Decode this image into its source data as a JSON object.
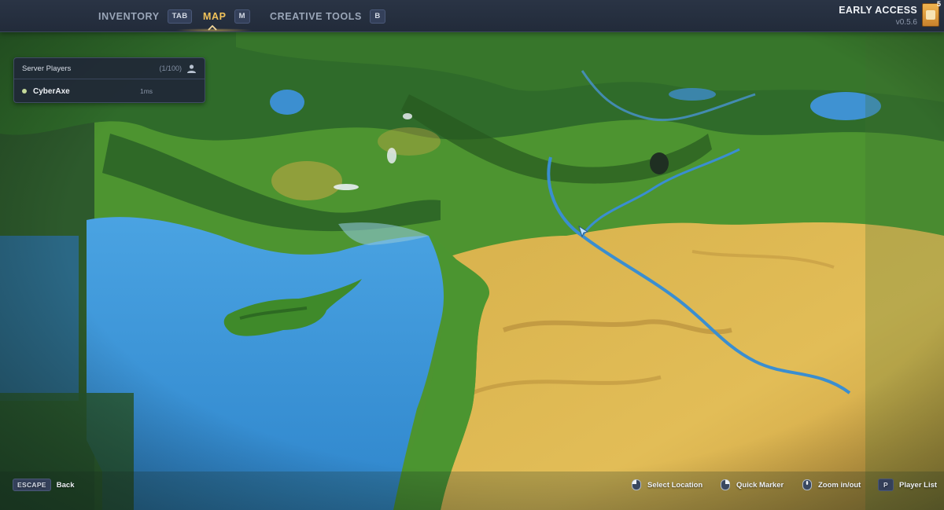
{
  "topbar": {
    "tabs": [
      {
        "label": "INVENTORY",
        "key": "TAB",
        "active": false
      },
      {
        "label": "MAP",
        "key": "M",
        "active": true
      },
      {
        "label": "CREATIVE TOOLS",
        "key": "B",
        "active": false
      }
    ],
    "early_access": {
      "title": "EARLY ACCESS",
      "version": "v0.5.6"
    },
    "badge": {
      "count": "5"
    }
  },
  "players_panel": {
    "title": "Server Players",
    "count": "(1/100)",
    "icon": "user-icon",
    "players": [
      {
        "name": "CyberAxe",
        "ping": "1ms",
        "status_color": "#c4d99a"
      }
    ]
  },
  "hints": {
    "escape": {
      "key": "ESCAPE",
      "label": "Back"
    },
    "select": {
      "icon": "mouse-left-icon",
      "label": "Select Location"
    },
    "marker": {
      "icon": "mouse-right-icon",
      "label": "Quick Marker"
    },
    "zoom": {
      "icon": "mouse-wheel-icon",
      "label": "Zoom in/out"
    },
    "players": {
      "key": "P",
      "label": "Player List"
    }
  },
  "colors": {
    "accent": "#f2c35a",
    "panel_bg": "#202837",
    "sea": "#3a8fd6",
    "grass": "#4f9a2e",
    "forest": "#2f6b2a",
    "desert": "#d9b24e"
  }
}
